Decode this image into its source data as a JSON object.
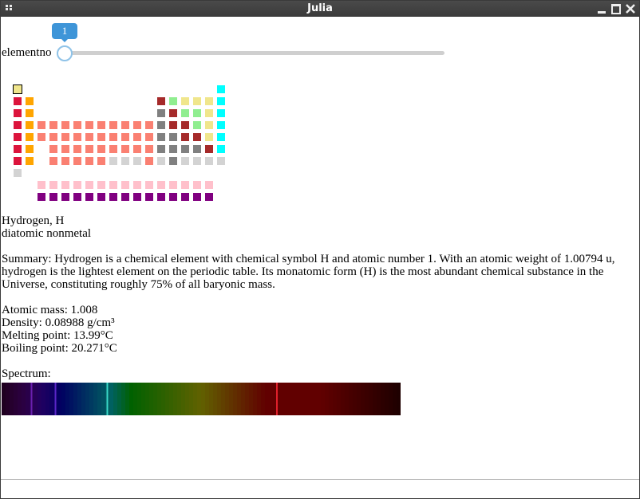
{
  "window": {
    "title": "Julia"
  },
  "slider": {
    "label": "elementno",
    "value": "1"
  },
  "element": {
    "name_line": "Hydrogen, H",
    "category": "diatomic nonmetal",
    "summary": "Summary: Hydrogen is a chemical element with chemical symbol H and atomic number 1. With an atomic weight of 1.00794 u, hydrogen is the lightest element on the periodic table. Its monatomic form (H) is the most abundant chemical substance in the Universe, constituting roughly 75% of all baryonic mass.",
    "atomic_mass": "Atomic mass: 1.008",
    "density": "Density: 0.08988 g/cm³",
    "melting_point": "Melting point: 13.99°C",
    "boiling_point": "Boiling point: 20.271°C",
    "spectrum_label": "Spectrum:"
  },
  "spectrum_lines": [
    {
      "nm": 410,
      "color": "#6a1fb0"
    },
    {
      "nm": 434,
      "color": "#5a26c9"
    },
    {
      "nm": 486,
      "color": "#39d8c8"
    },
    {
      "nm": 656,
      "color": "#e0202a"
    }
  ],
  "colors": {
    "alkali": "#dc143c",
    "alkaline": "#ffa500",
    "transition": "#fa8072",
    "post_transition": "#808080",
    "metalloid": "#cd853f",
    "poly_nonmetal": "#a52a2a",
    "diatomic_nonmetal": "#f0e68c",
    "polyatomic": "#90ee90",
    "noble": "#00ffff",
    "unknown": "#d3d3d3",
    "lanthanide": "#ffc0cb",
    "actinide": "#800080"
  }
}
